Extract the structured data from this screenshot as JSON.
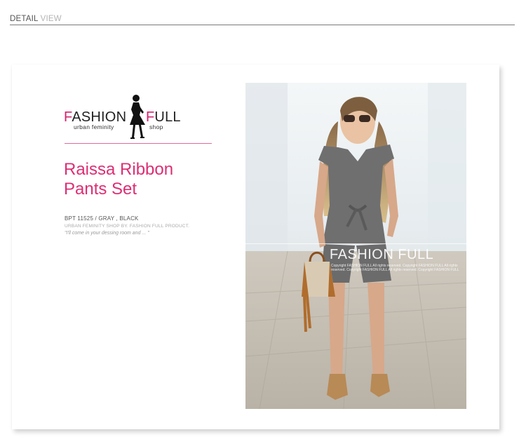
{
  "header": {
    "detail": "DETAIL",
    "view": "VIEW"
  },
  "logo": {
    "word1_initial": "F",
    "word1_rest": "ASHION",
    "word2_initial": "F",
    "word2_rest": "ULL",
    "tagline1": "urban feminity",
    "tagline2": "shop",
    "icon": "silhouette-woman-icon"
  },
  "product": {
    "title": "Raissa Ribbon Pants Set",
    "code": "BPT 11525 / GRAY , BLACK",
    "shop_line": "URBAN FEMINITY SHOP BY. FASHION FULL PRODUCT.",
    "quote": "\"I'll come in your dessing room and ... \""
  },
  "photo": {
    "watermark": "FASHION FULL",
    "watermark_small": "Copyright FASHION FULL All rights reserved. Copyright FASHION FULL All rights reserved. Copyright FASHION FULL All rights reserved. Copyright FASHION FULL"
  },
  "colors": {
    "accent": "#dd2e73",
    "divider": "#e46a9a",
    "header_line": "#7a7a7a"
  }
}
